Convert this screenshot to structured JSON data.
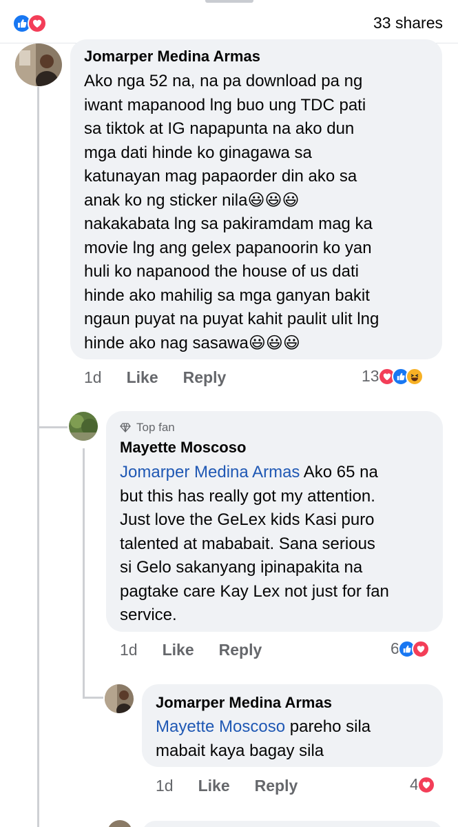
{
  "header": {
    "shares": "33 shares",
    "reactions": [
      "like-icon",
      "love-icon"
    ]
  },
  "comments": [
    {
      "author": "Jomarper Medina Armas",
      "text_lines": [
        "Ako nga 52 na, na pa download pa ng",
        "iwant mapanood lng buo ung TDC pati",
        "sa tiktok at IG napapunta na ako dun",
        "mga dati hinde ko ginagawa sa",
        "katunayan mag papaorder din ako sa",
        "anak ko  ng sticker nila😃😃😃",
        "nakakabata lng sa pakiramdam mag ka",
        "movie lng ang gelex papanoorin ko yan",
        "huli ko napanood the house of us dati",
        "hinde ako mahilig sa mga ganyan bakit",
        "ngaun puyat na puyat kahit paulit ulit lng",
        "hinde ako nag sasawa😃😃😃"
      ],
      "time": "1d",
      "like_label": "Like",
      "reply_label": "Reply",
      "reaction_count": "13",
      "reactions": [
        "love-icon",
        "like-icon",
        "haha-icon"
      ]
    },
    {
      "badge": "Top fan",
      "author": "Mayette Moscoso",
      "mention": "Jomarper Medina Armas",
      "first_line_rest": " Ako 65 na",
      "text_lines": [
        "but this has really got my attention.",
        "Just love the GeLex kids Kasi puro",
        "talented at mababait. Sana serious",
        "si Gelo sakanyang ipinapakita na",
        "pagtake care Kay Lex not just for fan",
        "service."
      ],
      "time": "1d",
      "like_label": "Like",
      "reply_label": "Reply",
      "reaction_count": "6",
      "reactions": [
        "like-icon",
        "love-icon"
      ]
    },
    {
      "author": "Jomarper Medina Armas",
      "mention": "Mayette Moscoso",
      "first_line_rest": " pareho sila",
      "text_lines": [
        "mabait kaya bagay sila"
      ],
      "time": "1d",
      "like_label": "Like",
      "reply_label": "Reply",
      "reaction_count": "4",
      "reactions": [
        "love-icon"
      ]
    }
  ],
  "colors": {
    "like": "#1877f2",
    "love": "#f33e58",
    "haha": "#f7b125",
    "mention": "#1f58b4",
    "bubble": "#f0f2f5",
    "secondary_text": "#65676b"
  }
}
